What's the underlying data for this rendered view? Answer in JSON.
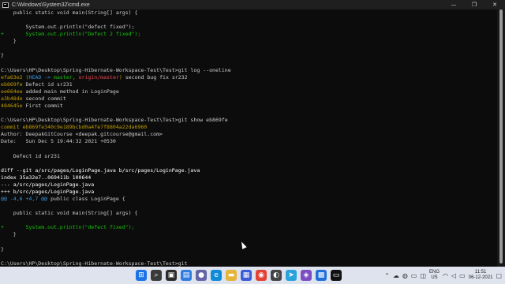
{
  "window": {
    "title": "C:\\Windows\\System32\\cmd.exe",
    "minimize_glyph": "—",
    "maximize_glyph": "❐",
    "close_glyph": "✕"
  },
  "colors": {
    "default": "#cccccc",
    "hash": "#c19c00",
    "head": "#3b78ff",
    "remote": "#e74856",
    "cyan": "#3a96dd",
    "added": "#16c60c",
    "meta": "#ffffff"
  },
  "console": {
    "lines": [
      [
        {
          "t": "    public static void main(String[] args) {",
          "c": "default"
        }
      ],
      [
        {
          "t": "",
          "c": "default"
        }
      ],
      [
        {
          "t": "        System.out.println(\"defect fixed\");",
          "c": "default"
        }
      ],
      [
        {
          "t": "+       System.out.println(\"Defect 2 fixed\");",
          "c": "added"
        }
      ],
      [
        {
          "t": "    }",
          "c": "default"
        }
      ],
      [
        {
          "t": "",
          "c": "default"
        }
      ],
      [
        {
          "t": "}",
          "c": "default"
        }
      ],
      [
        {
          "t": "",
          "c": "default"
        }
      ],
      [
        {
          "t": "C:\\Users\\HP\\Desktop\\Spring-Hibernate-Workspace-Test\\Test>git log --oneline",
          "c": "default"
        }
      ],
      [
        {
          "t": "efa63e2 ",
          "c": "hash"
        },
        {
          "t": "(",
          "c": "hash"
        },
        {
          "t": "HEAD -> ",
          "c": "cyan"
        },
        {
          "t": "master",
          "c": "added"
        },
        {
          "t": ", ",
          "c": "hash"
        },
        {
          "t": "origin/master",
          "c": "remote"
        },
        {
          "t": ")",
          "c": "hash"
        },
        {
          "t": " second bug fix sr232",
          "c": "default"
        }
      ],
      [
        {
          "t": "eb869fe",
          "c": "hash"
        },
        {
          "t": " Defect id sr231",
          "c": "default"
        }
      ],
      [
        {
          "t": "ee664ee",
          "c": "hash"
        },
        {
          "t": " added main method in LoginPage",
          "c": "default"
        }
      ],
      [
        {
          "t": "a3b48de",
          "c": "hash"
        },
        {
          "t": " second commit",
          "c": "default"
        }
      ],
      [
        {
          "t": "484645e",
          "c": "hash"
        },
        {
          "t": " First commit",
          "c": "default"
        }
      ],
      [
        {
          "t": "",
          "c": "default"
        }
      ],
      [
        {
          "t": "C:\\Users\\HP\\Desktop\\Spring-Hibernate-Workspace-Test\\Test>git show eb869fe",
          "c": "default"
        }
      ],
      [
        {
          "t": "commit eb869fe340c9e189bcbd0a4fe7f8804a22da6960",
          "c": "hash"
        }
      ],
      [
        {
          "t": "Author: DeepakGitCourse <deepak.gitcourse@gmail.com>",
          "c": "default"
        }
      ],
      [
        {
          "t": "Date:   Sun Dec 5 19:44:32 2021 +0530",
          "c": "default"
        }
      ],
      [
        {
          "t": "",
          "c": "default"
        }
      ],
      [
        {
          "t": "    Defect id sr231",
          "c": "default"
        }
      ],
      [
        {
          "t": "",
          "c": "default"
        }
      ],
      [
        {
          "t": "diff --git a/src/pages/LoginPage.java b/src/pages/LoginPage.java",
          "c": "meta"
        }
      ],
      [
        {
          "t": "index 35a32e7..069411b 100644",
          "c": "meta"
        }
      ],
      [
        {
          "t": "--- a/src/pages/LoginPage.java",
          "c": "meta"
        }
      ],
      [
        {
          "t": "+++ b/src/pages/LoginPage.java",
          "c": "meta"
        }
      ],
      [
        {
          "t": "@@ -4,6 +4,7 @@",
          "c": "cyan"
        },
        {
          "t": " public class LoginPage {",
          "c": "default"
        }
      ],
      [
        {
          "t": "",
          "c": "default"
        }
      ],
      [
        {
          "t": "    public static void main(String[] args) {",
          "c": "default"
        }
      ],
      [
        {
          "t": "",
          "c": "default"
        }
      ],
      [
        {
          "t": "+       System.out.println(\"defect fixed\");",
          "c": "added"
        }
      ],
      [
        {
          "t": "    }",
          "c": "default"
        }
      ],
      [
        {
          "t": "",
          "c": "default"
        }
      ],
      [
        {
          "t": "}",
          "c": "default"
        }
      ],
      [
        {
          "t": "",
          "c": "default"
        }
      ],
      [
        {
          "t": "C:\\Users\\HP\\Desktop\\Spring-Hibernate-Workspace-Test\\Test>git",
          "c": "default"
        }
      ]
    ]
  },
  "taskbar": {
    "apps": [
      {
        "name": "windows-start-icon",
        "glyph": "⊞",
        "bg": "#1a73e8"
      },
      {
        "name": "search-icon",
        "glyph": "⌕",
        "bg": "#3a3a3a"
      },
      {
        "name": "task-view-icon",
        "glyph": "▣",
        "bg": "#2b2b2b"
      },
      {
        "name": "widgets-icon",
        "glyph": "▤",
        "bg": "#2f7de1"
      },
      {
        "name": "chat-icon",
        "glyph": "●",
        "bg": "#6264a7"
      },
      {
        "name": "edge-icon",
        "glyph": "e",
        "bg": "#0f8bd9"
      },
      {
        "name": "file-explorer-icon",
        "glyph": "▬",
        "bg": "#e8b339"
      },
      {
        "name": "store-icon",
        "glyph": "▦",
        "bg": "#3c5bd6"
      },
      {
        "name": "chrome-icon",
        "glyph": "◉",
        "bg": "#e34133"
      },
      {
        "name": "app-icon",
        "glyph": "◐",
        "bg": "#444444"
      },
      {
        "name": "telegram-icon",
        "glyph": "➤",
        "bg": "#2aa3dd"
      },
      {
        "name": "visual-studio-icon",
        "glyph": "◈",
        "bg": "#7b4fc2"
      },
      {
        "name": "app-icon-2",
        "glyph": "▩",
        "bg": "#1e6fd9"
      },
      {
        "name": "terminal-icon",
        "glyph": "▭",
        "bg": "#111111"
      }
    ],
    "language": "ENG",
    "region": "US",
    "time": "11:51",
    "date": "06-12-2021"
  }
}
